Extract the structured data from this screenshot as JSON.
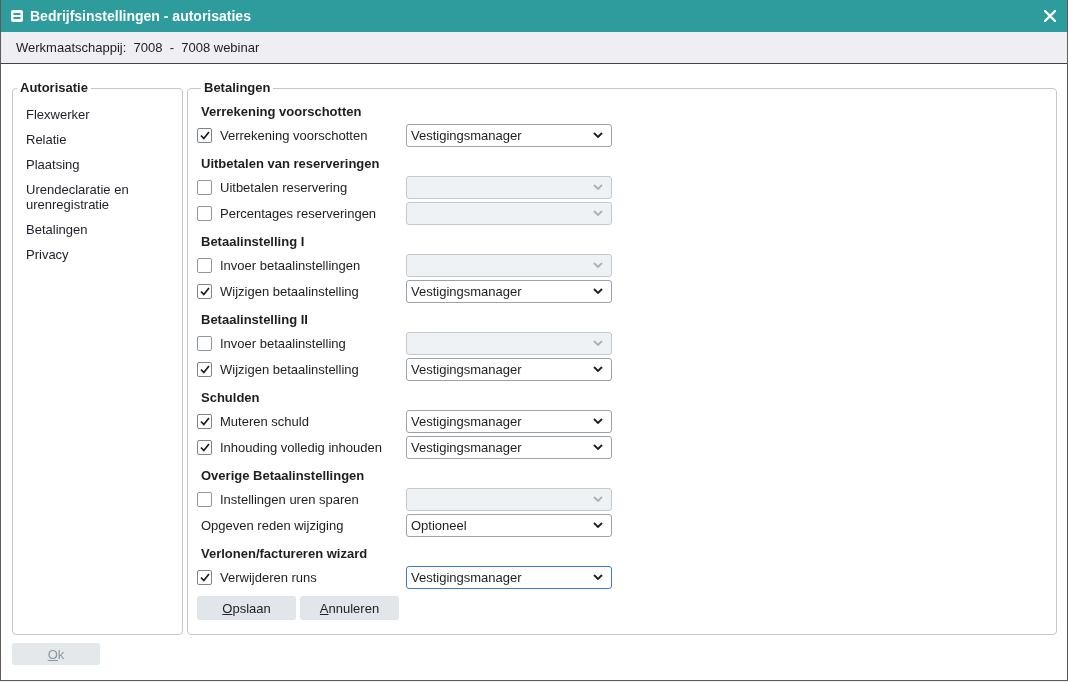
{
  "window": {
    "title": "Bedrijfsinstellingen - autorisaties"
  },
  "company_bar": {
    "text": "Werkmaatschappij:  7008  -  7008 webinar"
  },
  "sidebar": {
    "title": "Autorisatie",
    "items": [
      {
        "label": "Flexwerker",
        "selected": false
      },
      {
        "label": "Relatie",
        "selected": false
      },
      {
        "label": "Plaatsing",
        "selected": false
      },
      {
        "label": "Urendeclaratie en urenregistratie",
        "selected": false
      },
      {
        "label": "Betalingen",
        "selected": false
      },
      {
        "label": "Privacy",
        "selected": false
      }
    ]
  },
  "panel": {
    "title": "Betalingen",
    "sections": [
      {
        "title": "Verrekening voorschotten",
        "rows": [
          {
            "kind": "checkbox",
            "label": "Verrekening voorschotten",
            "checked": true,
            "select": {
              "value": "Vestigingsmanager",
              "disabled": false,
              "focused": false
            }
          }
        ]
      },
      {
        "title": "Uitbetalen van reserveringen",
        "rows": [
          {
            "kind": "checkbox",
            "label": "Uitbetalen reservering",
            "checked": false,
            "select": {
              "disabled": true,
              "focused": false
            }
          },
          {
            "kind": "checkbox",
            "label": "Percentages reserveringen",
            "checked": false,
            "select": {
              "disabled": true,
              "focused": false
            }
          }
        ]
      },
      {
        "title": "Betaalinstelling I",
        "rows": [
          {
            "kind": "checkbox",
            "label": "Invoer betaalinstellingen",
            "checked": false,
            "select": {
              "disabled": true,
              "focused": false
            }
          },
          {
            "kind": "checkbox",
            "label": "Wijzigen betaalinstelling",
            "checked": true,
            "select": {
              "value": "Vestigingsmanager",
              "disabled": false,
              "focused": false
            }
          }
        ]
      },
      {
        "title": "Betaalinstelling II",
        "rows": [
          {
            "kind": "checkbox",
            "label": "Invoer betaalinstelling",
            "checked": false,
            "select": {
              "disabled": true,
              "focused": false
            }
          },
          {
            "kind": "checkbox",
            "label": "Wijzigen betaalinstelling",
            "checked": true,
            "select": {
              "value": "Vestigingsmanager",
              "disabled": false,
              "focused": false
            }
          }
        ]
      },
      {
        "title": "Schulden",
        "rows": [
          {
            "kind": "checkbox",
            "label": "Muteren schuld",
            "checked": true,
            "select": {
              "value": "Vestigingsmanager",
              "disabled": false,
              "focused": false
            }
          },
          {
            "kind": "checkbox",
            "label": "Inhouding volledig inhouden",
            "checked": true,
            "select": {
              "value": "Vestigingsmanager",
              "disabled": false,
              "focused": false
            }
          }
        ]
      },
      {
        "title": "Overige Betaalinstellingen",
        "rows": [
          {
            "kind": "checkbox",
            "label": "Instellingen uren sparen",
            "checked": false,
            "select": {
              "disabled": true,
              "focused": false
            }
          },
          {
            "kind": "plain",
            "label": "Opgeven reden wijziging",
            "select": {
              "value": "Optioneel",
              "disabled": false,
              "focused": false
            }
          }
        ]
      },
      {
        "title": "Verlonen/factureren wizard",
        "rows": [
          {
            "kind": "checkbox",
            "label": "Verwijderen runs",
            "checked": true,
            "select": {
              "value": "Vestigingsmanager",
              "disabled": false,
              "focused": true
            }
          }
        ]
      }
    ],
    "buttons": [
      {
        "label": "Opslaan"
      },
      {
        "label": "Annuleren"
      }
    ]
  },
  "footer": {
    "ok_button": {
      "label": "Ok",
      "disabled": true
    }
  }
}
